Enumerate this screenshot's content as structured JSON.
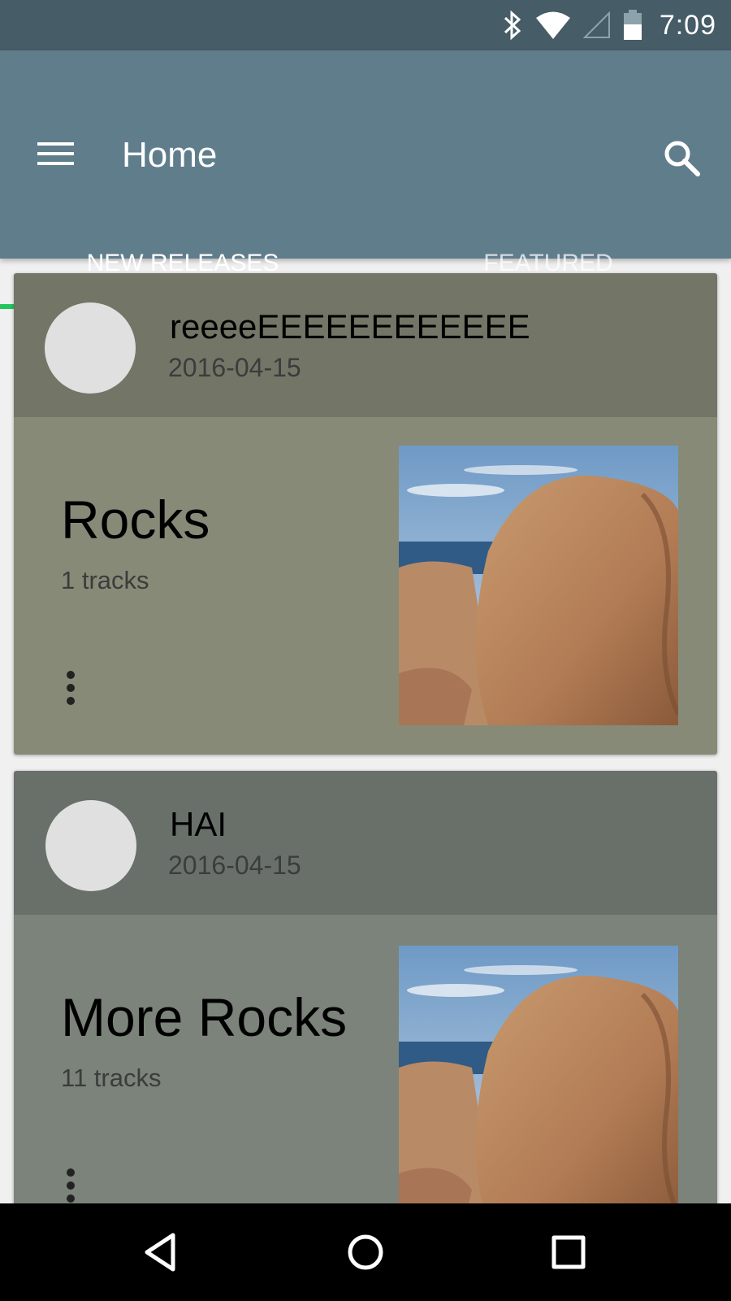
{
  "status": {
    "time": "7:09",
    "icons": [
      "bluetooth-icon",
      "wifi-icon",
      "signal-icon",
      "battery-icon"
    ]
  },
  "appbar": {
    "title": "Home",
    "menu_icon": "menu-icon",
    "search_icon": "search-icon"
  },
  "tabs": [
    {
      "label": "NEW RELEASES",
      "active": true
    },
    {
      "label": "FEATURED",
      "active": false
    }
  ],
  "releases": [
    {
      "artist": "reeeeEEEEEEEEEEEE",
      "date": "2016-04-15",
      "title": "Rocks",
      "tracks": "1 tracks",
      "header_color": "#737567",
      "body_color": "#888a78"
    },
    {
      "artist": "HAI",
      "date": "2016-04-15",
      "title": "More Rocks",
      "tracks": "11 tracks",
      "header_color": "#69706a",
      "body_color": "#7b837a"
    }
  ],
  "navbar": {
    "icons": [
      "back-icon",
      "home-icon",
      "recents-icon"
    ]
  },
  "colors": {
    "status_bar": "#465c67",
    "app_bar": "#607d8b",
    "tab_indicator": "#22c55e"
  }
}
